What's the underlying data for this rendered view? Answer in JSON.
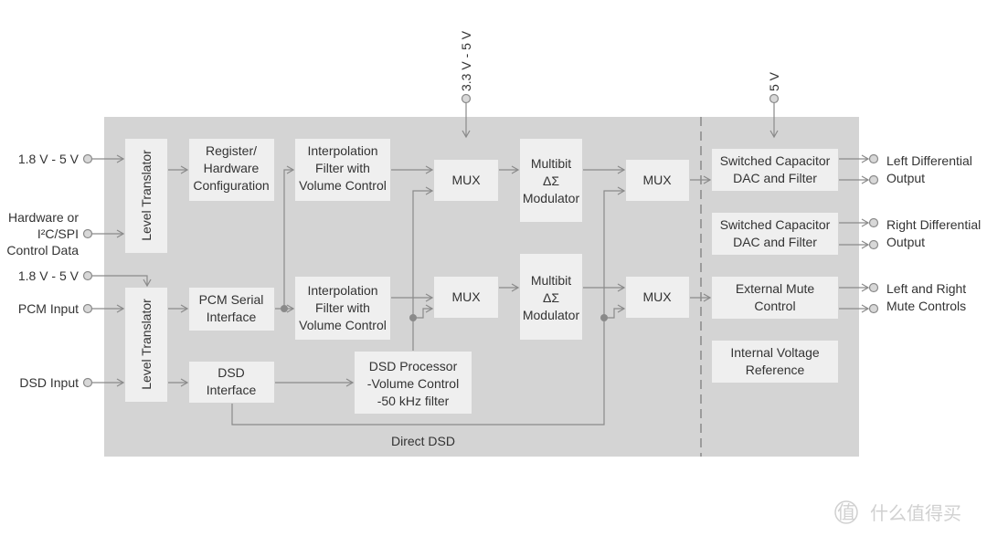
{
  "supply_top": {
    "center": "3.3 V - 5 V",
    "right": "5 V"
  },
  "inputs": {
    "supply1": "1.8 V - 5 V",
    "control": [
      "Hardware or",
      "I²C/SPI",
      "Control Data"
    ],
    "supply2": "1.8 V - 5 V",
    "pcm": "PCM Input",
    "dsd": "DSD Input"
  },
  "blocks": {
    "level_translator_1": "Level Translator",
    "level_translator_2": "Level Translator",
    "register_config": [
      "Register/",
      "Hardware",
      "Configuration"
    ],
    "pcm_serial": [
      "PCM Serial",
      "Interface"
    ],
    "dsd_interface": [
      "DSD",
      "Interface"
    ],
    "interp_1": [
      "Interpolation",
      "Filter with",
      "Volume Control"
    ],
    "interp_2": [
      "Interpolation",
      "Filter with",
      "Volume  Control"
    ],
    "mux": "MUX",
    "modulator": [
      "Multibit",
      "ΔΣ",
      "Modulator"
    ],
    "dsd_processor": [
      "DSD Processor",
      "-Volume Control",
      "-50 kHz filter"
    ],
    "sc_dac_1": [
      "Switched Capacitor",
      "DAC and Filter"
    ],
    "sc_dac_2": [
      "Switched Capacitor",
      "DAC and Filter"
    ],
    "ext_mute": [
      "External Mute",
      "Control"
    ],
    "int_vref": [
      "Internal Voltage",
      "Reference"
    ],
    "direct_dsd": "Direct DSD"
  },
  "outputs": {
    "left": [
      "Left Differential",
      "Output"
    ],
    "right": [
      "Right Differential",
      "Output"
    ],
    "mute": [
      "Left and Right",
      "Mute Controls"
    ]
  },
  "watermark": {
    "logo": "值",
    "text": "什么值得买"
  },
  "colors": {
    "panel": "#d4d4d4",
    "block": "#efefef",
    "line": "#8a8a8a"
  }
}
